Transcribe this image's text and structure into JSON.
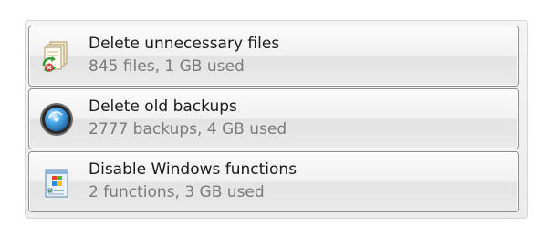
{
  "items": [
    {
      "icon": "recycle-files-icon",
      "title": "Delete unnecessary files",
      "subtitle": "845 files, 1 GB used"
    },
    {
      "icon": "backup-disc-icon",
      "title": "Delete old backups",
      "subtitle": "2777 backups, 4 GB used"
    },
    {
      "icon": "windows-features-icon",
      "title": "Disable Windows functions",
      "subtitle": "2 functions, 3 GB used"
    }
  ]
}
